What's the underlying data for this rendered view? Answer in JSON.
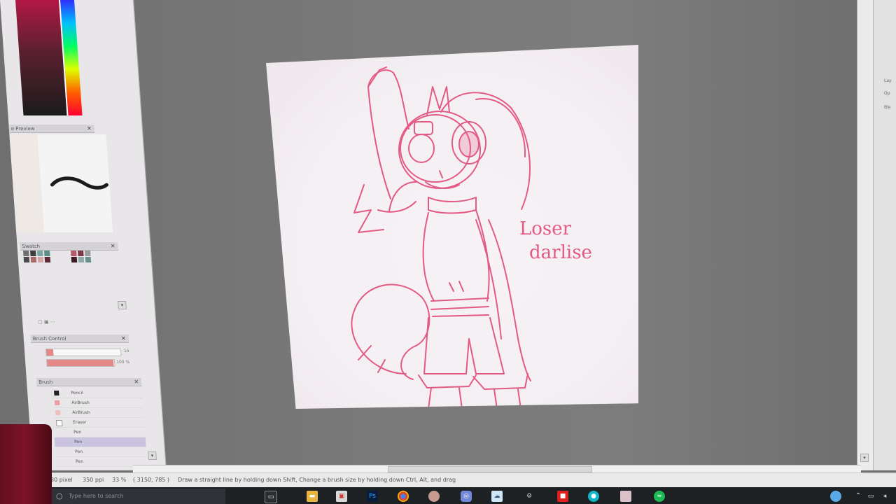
{
  "app": {
    "panels": {
      "preview_title": "e Preview",
      "palette_title": "Swatch",
      "brush_controls_title": "Brush Control",
      "brush_title": "Brush"
    },
    "brush_controls": {
      "size_value": "15",
      "opacity_value": "100 %"
    },
    "brushes": [
      {
        "label": "Pencil"
      },
      {
        "label": "AirBrush"
      },
      {
        "label": "AirBrush"
      },
      {
        "label": "Eraser"
      },
      {
        "label": "Pen"
      },
      {
        "label": "Pen"
      },
      {
        "label": "Pen"
      },
      {
        "label": "Pen"
      }
    ],
    "swatch_colors": [
      "#6f6f6f",
      "#3d3d3d",
      "#7aa6a6",
      "#5d8f8a",
      "#b35a6b",
      "#7a3a4a",
      "#9c9c9c",
      "#4a4a4a",
      "#a86a6a",
      "#d8a5a5",
      "#5c2a34",
      "#3a1c22",
      "#8ea8a8",
      "#6b8f8f"
    ],
    "accent_pink": "#e35a83",
    "canvas_text": [
      "Loser",
      "darlise"
    ],
    "status": {
      "pixels": "80 pixel",
      "dpi": "350 ppi",
      "zoom": "33 %",
      "coords": "( 3150, 785 )",
      "hint": "Draw a straight line by holding down Shift, Change a brush size by holding down Ctrl, Alt, and drag"
    },
    "right_panel_labels": [
      "Lay",
      "Op",
      "Ble"
    ]
  },
  "taskbar": {
    "search_placeholder": "Type here to search",
    "icons": [
      "task-view-icon",
      "file-explorer-icon",
      "store-icon",
      "photoshop-icon",
      "chrome-icon",
      "app-icon",
      "discord-icon",
      "weather-icon",
      "steam-icon",
      "roblox-icon",
      "browser-icon",
      "avatar-icon",
      "spotify-icon"
    ]
  }
}
